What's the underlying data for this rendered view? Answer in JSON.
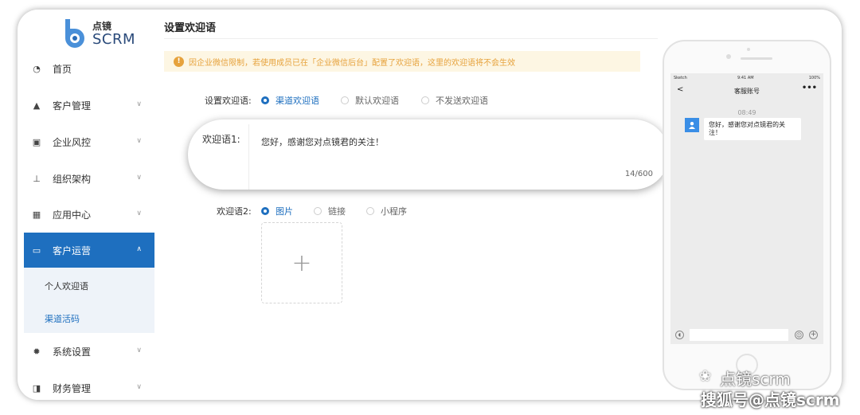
{
  "logo": {
    "top": "点镜",
    "bottom": "SCRM"
  },
  "sidebar": {
    "items": [
      {
        "label": "首页",
        "icon": "dashboard-icon"
      },
      {
        "label": "客户管理",
        "icon": "user-icon"
      },
      {
        "label": "企业风控",
        "icon": "shield-icon"
      },
      {
        "label": "组织架构",
        "icon": "org-icon"
      },
      {
        "label": "应用中心",
        "icon": "grid-icon"
      },
      {
        "label": "客户运营",
        "icon": "message-icon"
      },
      {
        "label": "系统设置",
        "icon": "gear-icon"
      },
      {
        "label": "财务管理",
        "icon": "wallet-icon"
      }
    ],
    "subitems": [
      "个人欢迎语",
      "渠道活码"
    ],
    "active_color": "#1e6fbf"
  },
  "main": {
    "title": "设置欢迎语",
    "warning": "因企业微信限制，若使用成员已在「企业微信后台」配置了欢迎语，这里的欢迎语将不会生效",
    "welcome_row": {
      "label": "设置欢迎语:",
      "options": [
        "渠道欢迎语",
        "默认欢迎语",
        "不发送欢迎语"
      ]
    },
    "greeting1": {
      "label": "欢迎语1:",
      "text": "您好，感谢您对点镜君的关注！",
      "count": "14/600"
    },
    "greeting2": {
      "label": "欢迎语2:",
      "options": [
        "图片",
        "链接",
        "小程序"
      ],
      "upload_plus": "+"
    }
  },
  "phone": {
    "status_left": "Sketch",
    "status_time": "9:41 AM",
    "status_right": "100%",
    "nav_back": "<",
    "nav_title": "客服账号",
    "nav_more": "•••",
    "time": "08:49",
    "message": "您好，感谢您对点镜君的关注！"
  },
  "watermark": {
    "line1": "点镜scrm",
    "line2": "搜狐号@点镜scrm"
  }
}
